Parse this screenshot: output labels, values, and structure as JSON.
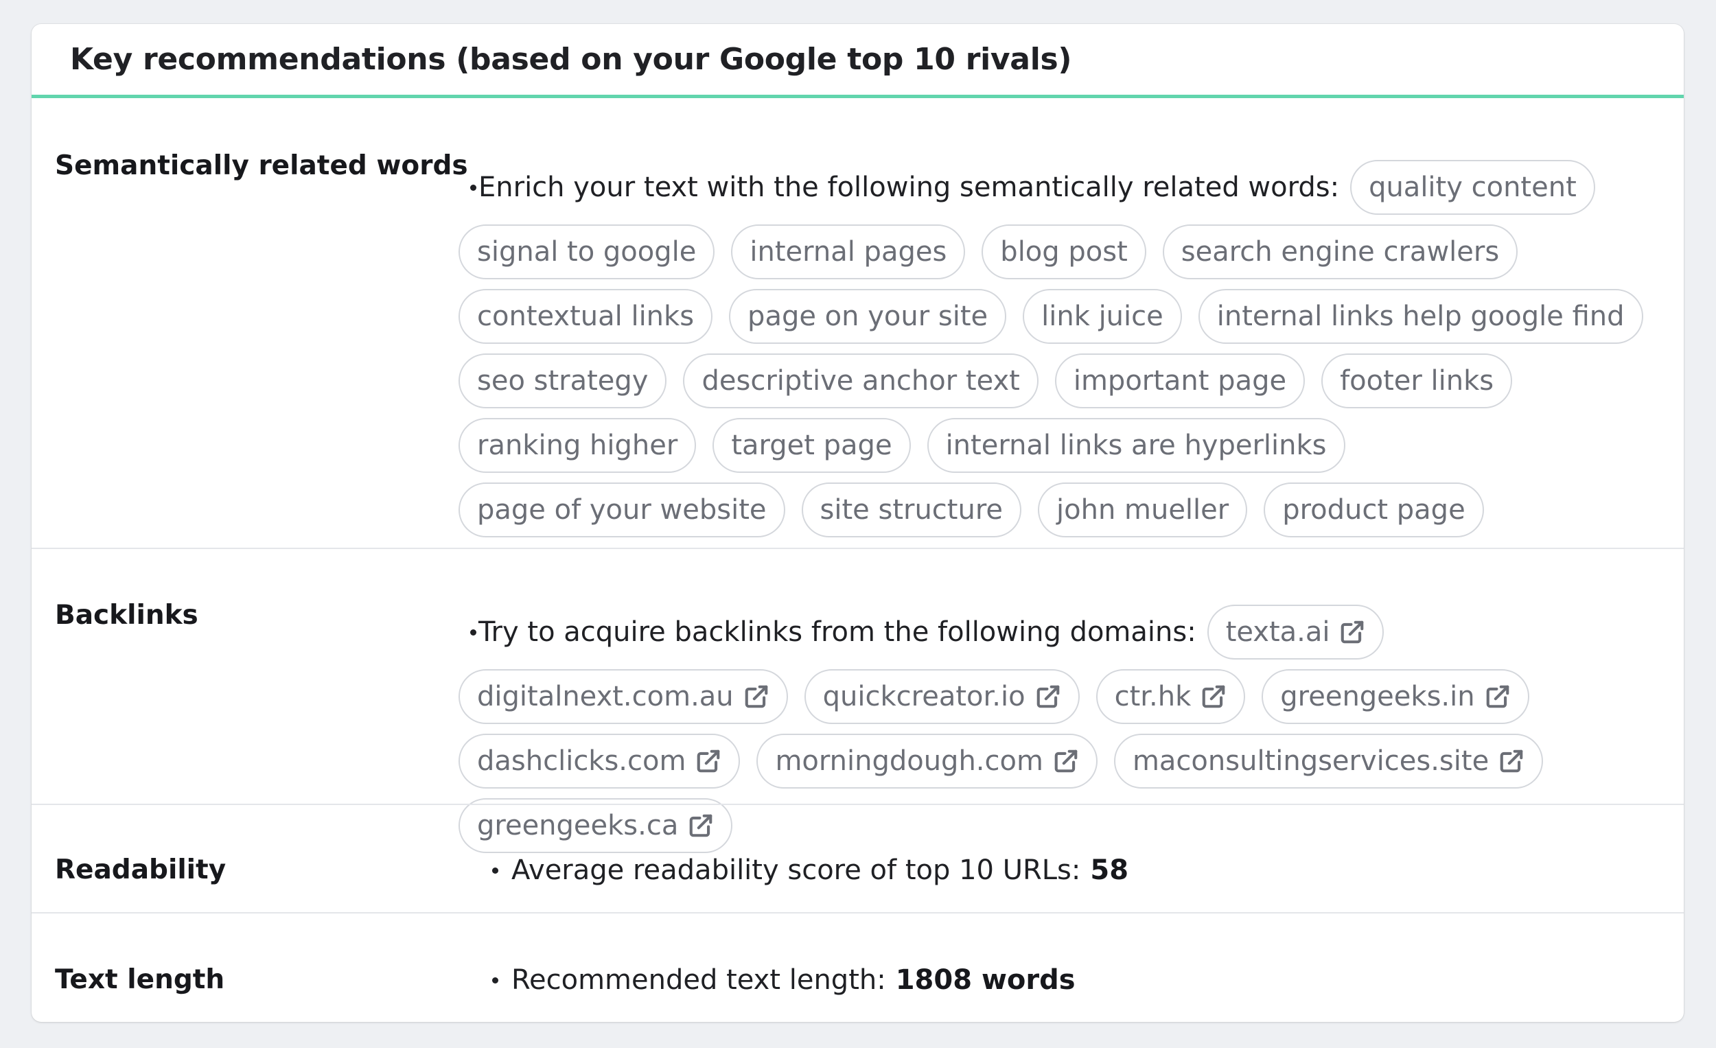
{
  "header": {
    "title": "Key recommendations (based on your Google top 10 rivals)"
  },
  "semantic": {
    "label": "Semantically related words",
    "intro": "Enrich your text with the following semantically related words:",
    "words": [
      "quality content",
      "signal to google",
      "internal pages",
      "blog post",
      "search engine crawlers",
      "contextual links",
      "page on your site",
      "link juice",
      "internal links help google find",
      "seo strategy",
      "descriptive anchor text",
      "important page",
      "footer links",
      "ranking higher",
      "target page",
      "internal links are hyperlinks",
      "page of your website",
      "site structure",
      "john mueller",
      "product page"
    ]
  },
  "backlinks": {
    "label": "Backlinks",
    "intro": "Try to acquire backlinks from the following domains:",
    "domains": [
      "texta.ai",
      "digitalnext.com.au",
      "quickcreator.io",
      "ctr.hk",
      "greengeeks.in",
      "dashclicks.com",
      "morningdough.com",
      "maconsultingservices.site",
      "greengeeks.ca"
    ],
    "icon": "external-link-icon"
  },
  "readability": {
    "label": "Readability",
    "text": "Average readability score of top 10 URLs:",
    "value": "58"
  },
  "text_length": {
    "label": "Text length",
    "text": "Recommended text length:",
    "value": "1808 words"
  },
  "colors": {
    "accent": "#61d5ad",
    "chip_border": "#d4d7dc",
    "chip_text": "#6b6e76",
    "background": "#eef0f3"
  }
}
